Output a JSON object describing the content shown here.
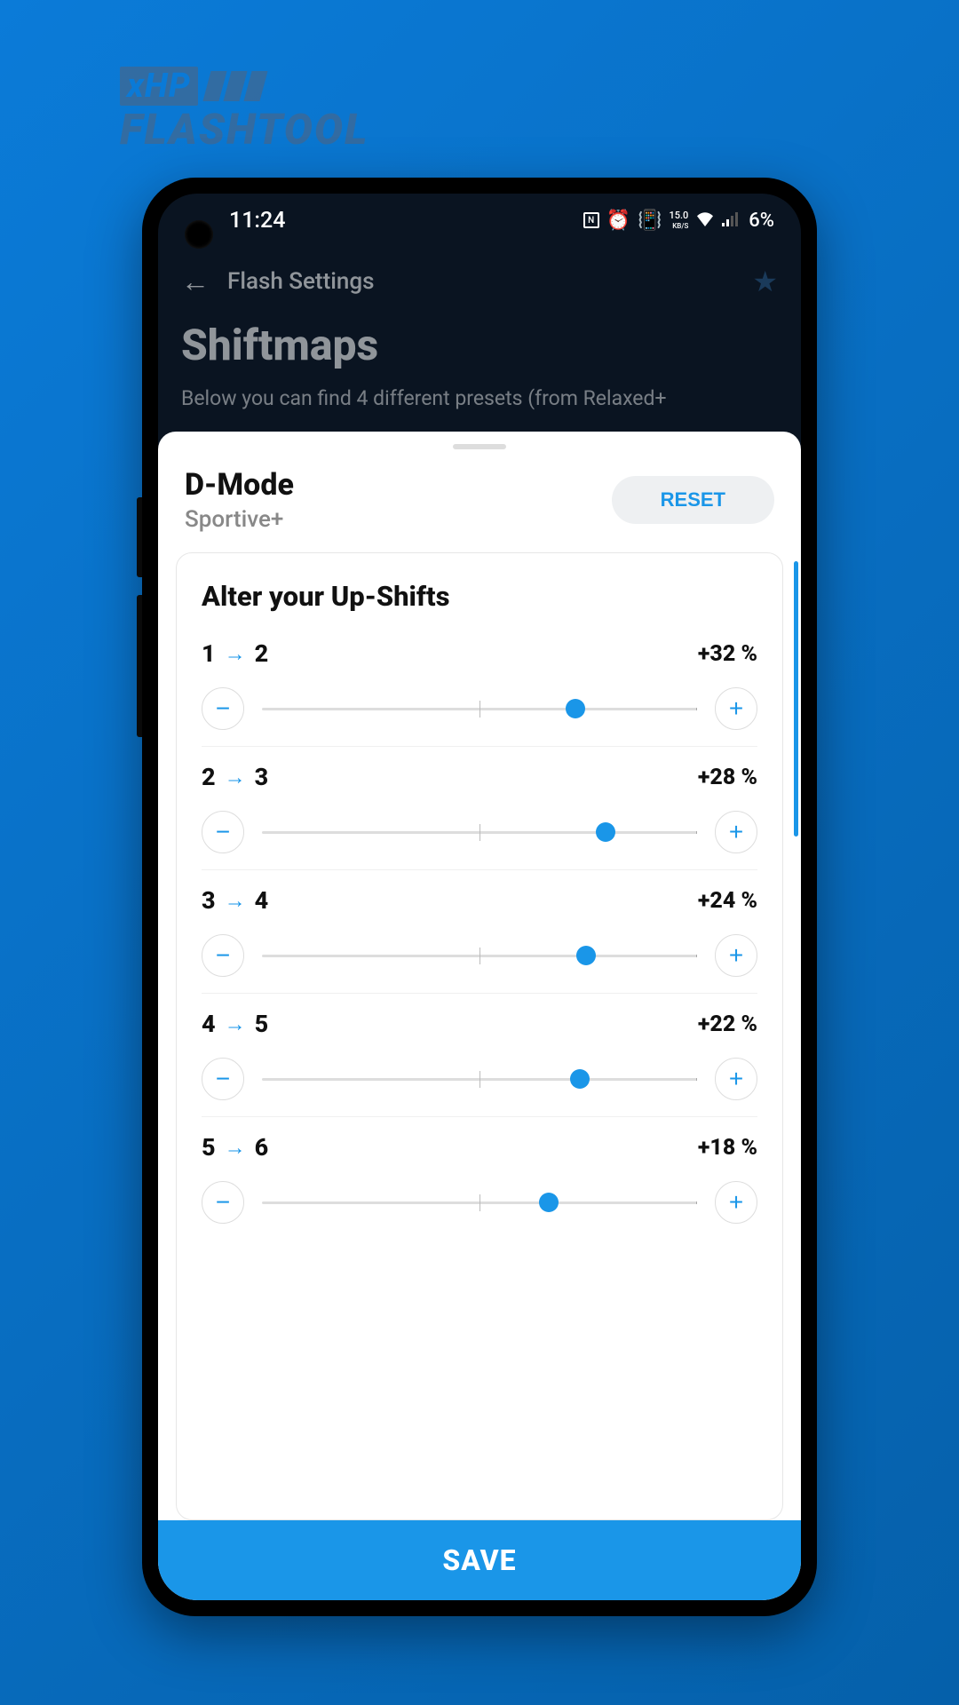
{
  "logo": {
    "top": "xHP",
    "bottom": "FLASHTOOL"
  },
  "statusbar": {
    "time": "11:24",
    "speed_top": "15.0",
    "speed_bottom": "KB/S",
    "battery": "6%"
  },
  "header": {
    "screen_title": "Flash Settings",
    "page_title": "Shiftmaps",
    "description": "Below you can find 4 different presets (from Relaxed+"
  },
  "sheet": {
    "mode_title": "D-Mode",
    "mode_subtitle": "Sportive+",
    "reset_label": "RESET",
    "card_title": "Alter your Up-Shifts"
  },
  "shifts": [
    {
      "from": "1",
      "to": "2",
      "value": "+32 %",
      "pos": 72
    },
    {
      "from": "2",
      "to": "3",
      "value": "+28 %",
      "pos": 79
    },
    {
      "from": "3",
      "to": "4",
      "value": "+24 %",
      "pos": 74.5
    },
    {
      "from": "4",
      "to": "5",
      "value": "+22 %",
      "pos": 73
    },
    {
      "from": "5",
      "to": "6",
      "value": "+18 %",
      "pos": 66
    }
  ],
  "save_label": "SAVE"
}
